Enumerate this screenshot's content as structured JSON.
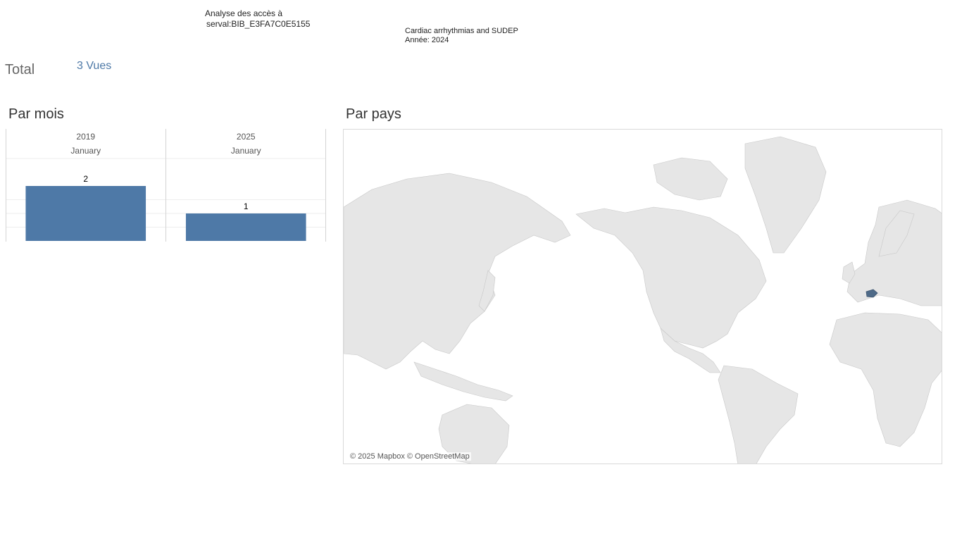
{
  "header": {
    "analysis_line1": "Analyse des accès à",
    "analysis_line2": "serval:BIB_E3FA7C0E5155",
    "doc_title": "Cardiac arrhythmias and SUDEP",
    "doc_year": "Année: 2024"
  },
  "summary": {
    "total_label": "Total",
    "total_value": "3 Vues"
  },
  "sections": {
    "by_month": "Par mois",
    "by_country": "Par pays"
  },
  "chart_data": {
    "type": "bar",
    "categories": [
      {
        "year": "2019",
        "month": "January"
      },
      {
        "year": "2025",
        "month": "January"
      }
    ],
    "values": [
      2,
      1
    ],
    "data_labels": [
      "2",
      "1"
    ],
    "ylim": [
      0,
      2
    ],
    "grid": true,
    "bar_color": "#4e79a7"
  },
  "map": {
    "attribution": "© 2025 Mapbox © OpenStreetMap",
    "highlighted_country": "Switzerland",
    "land_color": "#e6e6e6",
    "highlight_color": "#4e6a88"
  }
}
